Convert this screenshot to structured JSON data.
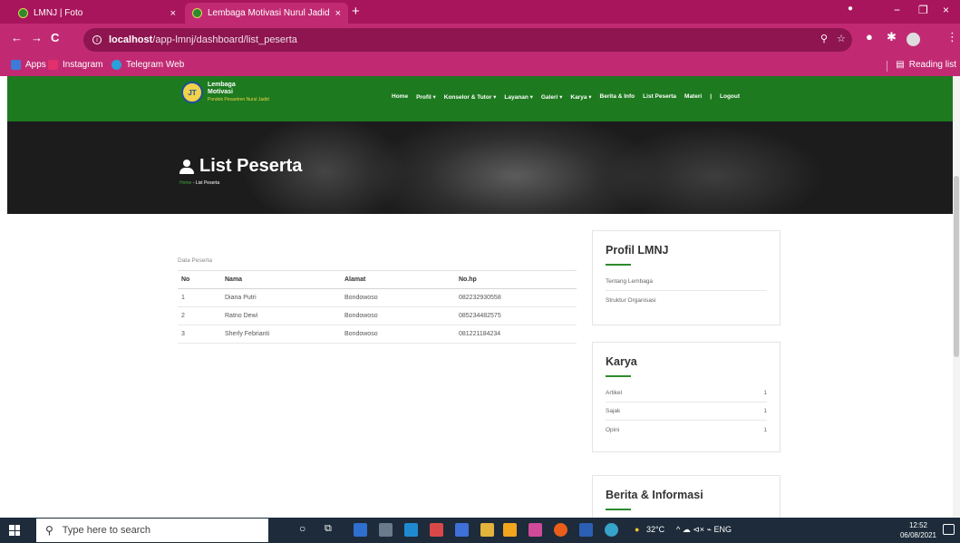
{
  "browser": {
    "tabs": [
      {
        "title": "LMNJ | Foto",
        "close": "×"
      },
      {
        "title": "Lembaga Motivasi Nurul Jadid",
        "close": "×"
      }
    ],
    "new_tab": "+",
    "window_controls": [
      "−",
      "❐",
      "×"
    ],
    "back": "←",
    "forward": "→",
    "reload": "C",
    "url_host": "localhost",
    "url_path": "/app-lmnj/dashboard/list_peserta",
    "bookmarks": [
      {
        "label": "Apps",
        "color": "#3d7bd8"
      },
      {
        "label": "Instagram",
        "color": "#e1306c"
      },
      {
        "label": "Telegram Web",
        "color": "#2aa1da"
      }
    ],
    "reading_list": "Reading list"
  },
  "site": {
    "logo": {
      "mark": "JT",
      "line1": "Lembaga",
      "line2": "Motivasi",
      "line3": "Pondok Pesantren Nurul Jadid"
    },
    "menu": [
      "Home",
      "Profil ▾",
      "Konselor & Tutor ▾",
      "Layanan ▾",
      "Galeri ▾",
      "Karya ▾",
      "Berita & Info",
      "List Peserta",
      "Materi",
      "|",
      "Logout"
    ],
    "hero_title": "List Peserta",
    "breadcrumb_home": "Home",
    "breadcrumb_current": " - List Peserta"
  },
  "table": {
    "caption": "Data Peserta",
    "headers": [
      "No",
      "Nama",
      "Alamat",
      "No.hp"
    ],
    "rows": [
      [
        "1",
        "Diana Putri",
        "Bondowoso",
        "082232930558"
      ],
      [
        "2",
        "Ratno Dewi",
        "Bondowoso",
        "085234482575"
      ],
      [
        "3",
        "Sherly Febrianti",
        "Bondowoso",
        "081221184234"
      ]
    ]
  },
  "sidebar": {
    "profil": {
      "title": "Profil LMNJ",
      "items": [
        "Tentang Lembaga",
        "Struktur Organisasi"
      ]
    },
    "karya": {
      "title": "Karya",
      "items": [
        {
          "label": "Artikel",
          "count": "1"
        },
        {
          "label": "Sajak",
          "count": "1"
        },
        {
          "label": "Opini",
          "count": "1"
        }
      ]
    },
    "berita": {
      "title": "Berita & Informasi"
    }
  },
  "taskbar": {
    "search_placeholder": "Type here to search",
    "weather": "32°C",
    "tray_text": "^  ☁  ⊲×  ⌁  ENG",
    "time": "12:52",
    "date": "06/08/2021"
  },
  "colors": {
    "brand_green": "#1d7a1f",
    "browser_magenta": "#c12a73"
  }
}
